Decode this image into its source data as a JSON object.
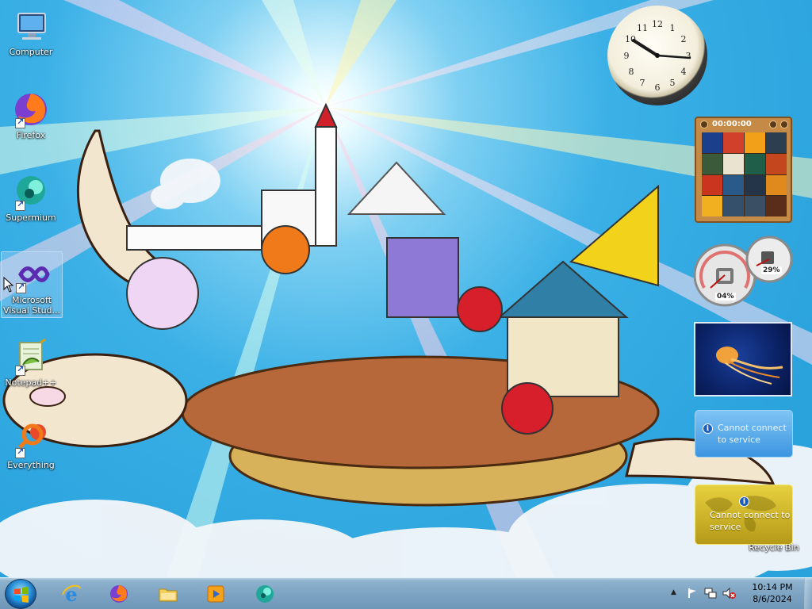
{
  "desktop": {
    "icons": [
      {
        "name": "computer",
        "label": "Computer"
      },
      {
        "name": "firefox",
        "label": "Firefox"
      },
      {
        "name": "supermium",
        "label": "Supermium"
      },
      {
        "name": "visual-studio",
        "label": "Microsoft Visual Stud..."
      },
      {
        "name": "notepad-plus-plus",
        "label": "Notepad++"
      },
      {
        "name": "everything",
        "label": "Everything"
      },
      {
        "name": "recycle-bin",
        "label": "Recycle Bin"
      }
    ]
  },
  "gadgets": {
    "clock": {
      "time": "10:14"
    },
    "puzzle": {
      "timer": "00:00:00"
    },
    "cpu_meter": {
      "cpu_label": "04%",
      "memory_label": "29%"
    },
    "weather": {
      "message": "Cannot connect to service"
    },
    "currency": {
      "message": "Cannot connect to service"
    }
  },
  "taskbar": {
    "pinned": [
      {
        "name": "internet-explorer"
      },
      {
        "name": "firefox"
      },
      {
        "name": "file-explorer"
      },
      {
        "name": "media-player"
      },
      {
        "name": "supermium"
      }
    ],
    "clock": {
      "time": "10:14 PM",
      "date": "8/6/2024"
    }
  },
  "colors": {
    "sky": "#2aa2dc",
    "taskbar": "#7ea4c3",
    "weather": "#3c95e0",
    "currency": "#c8ae24"
  }
}
